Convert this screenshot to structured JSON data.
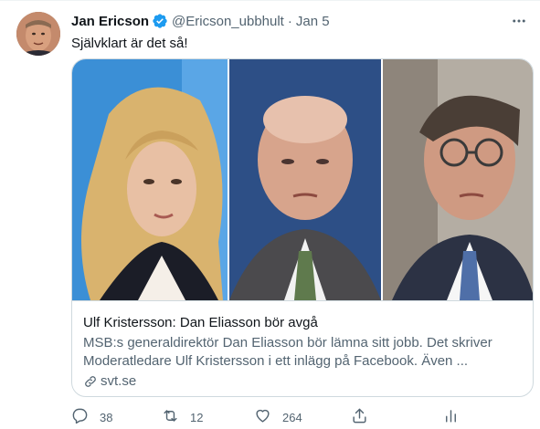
{
  "tweet": {
    "author_name": "Jan Ericson",
    "handle": "@Ericson_ubbhult",
    "separator": "·",
    "date": "Jan 5",
    "text": "Självklart är det så!",
    "verified": true
  },
  "card": {
    "title": "Ulf Kristersson: Dan Eliasson bör avgå",
    "description": "MSB:s generaldirektör Dan Eliasson bör lämna sitt jobb. Det skriver Moderatledare Ulf Kristersson i ett inlägg på Facebook. Även ...",
    "domain": "svt.se"
  },
  "actions": {
    "replies": "38",
    "retweets": "12",
    "likes": "264"
  },
  "colors": {
    "verified": "#1d9bf0",
    "secondary_text": "#536471",
    "border": "#cfd9de"
  },
  "icons": [
    "more-icon",
    "verified-badge-icon",
    "link-icon",
    "reply-icon",
    "retweet-icon",
    "like-icon",
    "share-icon",
    "analytics-icon"
  ]
}
